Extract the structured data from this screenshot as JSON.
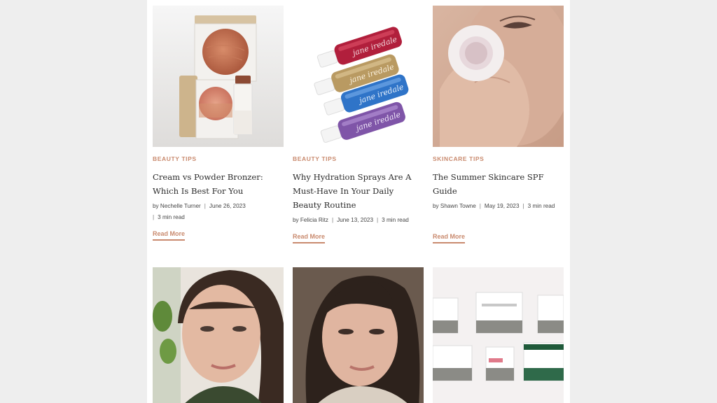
{
  "posts": [
    {
      "category": "BEAUTY TIPS",
      "title": "Cream vs Powder Bronzer: Which Is Best For You",
      "author": "by Nechelle Turner",
      "date": "June 26, 2023",
      "read_time": "3 min read",
      "read_more": "Read More",
      "image_icon": "bronzer-compacts-image"
    },
    {
      "category": "BEAUTY TIPS",
      "title": "Why Hydration Sprays Are A Must-Have In Your Daily Beauty Routine",
      "author": "by Felicia Ritz",
      "date": "June 13, 2023",
      "read_time": "3 min read",
      "read_more": "Read More",
      "image_icon": "hydration-spray-bottles-image",
      "bottle_text": "jane iredale"
    },
    {
      "category": "SKINCARE TIPS",
      "title": "The Summer Skincare SPF Guide",
      "author": "by Shawn Towne",
      "date": "May 19, 2023",
      "read_time": "3 min read",
      "read_more": "Read More",
      "image_icon": "spf-applicator-face-image"
    }
  ],
  "second_row": [
    {
      "image_icon": "woman-portrait-image"
    },
    {
      "image_icon": "woman-selfie-image"
    },
    {
      "image_icon": "skincare-jars-image"
    }
  ],
  "colors": {
    "accent": "#c98a6e",
    "background": "#eeeeee",
    "card": "#ffffff",
    "title": "#2b2b2b"
  }
}
